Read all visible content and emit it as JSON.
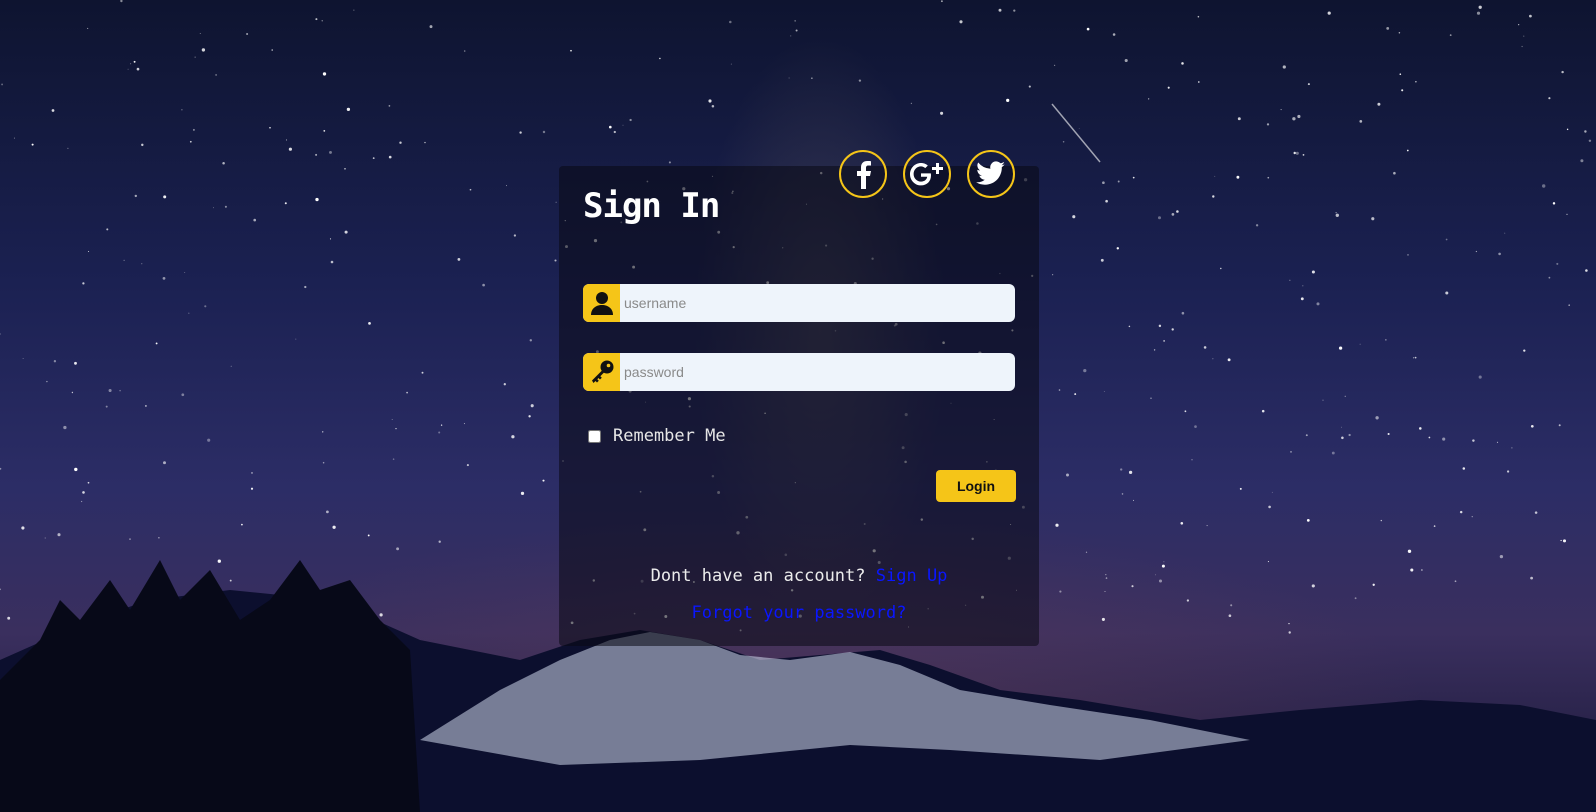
{
  "form": {
    "title": "Sign In",
    "username_placeholder": "username",
    "password_placeholder": "password",
    "remember_label": "Remember Me",
    "login_label": "Login",
    "signup_prompt": "Dont have an account?",
    "signup_link": "Sign Up",
    "forgot_link": "Forgot your password?"
  },
  "social": [
    "facebook-icon",
    "google-plus-icon",
    "twitter-icon"
  ],
  "colors": {
    "accent": "#f5c518",
    "link": "#0a16ff",
    "field_bg": "#eef4fb",
    "card_bg": "rgba(10,10,20,0.55)"
  }
}
